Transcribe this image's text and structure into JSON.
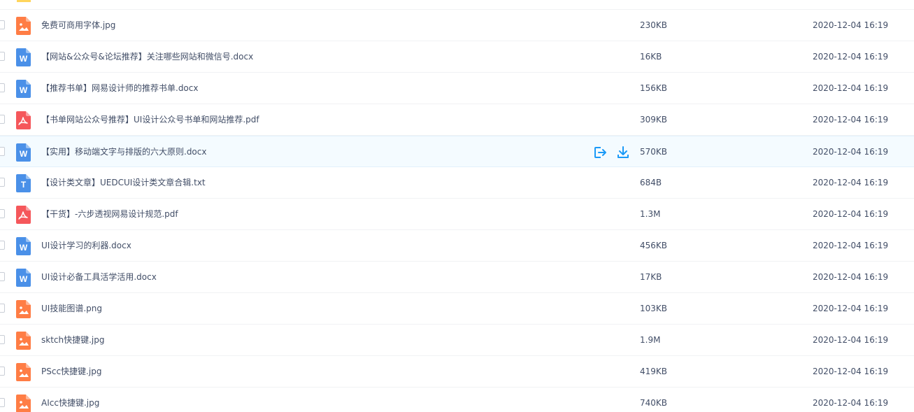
{
  "colors": {
    "word": "#4a90e8",
    "pdf": "#f5575b",
    "image": "#ff7d45",
    "txt": "#4a90e8",
    "folder": "#ffd55c",
    "action": "#1b9af7"
  },
  "files": [
    {
      "name": "免费可商用字体.jpg",
      "type": "image",
      "size": "230KB",
      "date": "2020-12-04 16:19"
    },
    {
      "name": "【网站&公众号&论坛推荐】关注哪些网站和微信号.docx",
      "type": "word",
      "size": "16KB",
      "date": "2020-12-04 16:19"
    },
    {
      "name": "【推荐书单】网易设计师的推荐书单.docx",
      "type": "word",
      "size": "156KB",
      "date": "2020-12-04 16:19"
    },
    {
      "name": "【书单网站公众号推荐】UI设计公众号书单和网站推荐.pdf",
      "type": "pdf",
      "size": "309KB",
      "date": "2020-12-04 16:19"
    },
    {
      "name": "【实用】移动端文字与排版的六大原则.docx",
      "type": "word",
      "size": "570KB",
      "date": "2020-12-04 16:19",
      "hover": true
    },
    {
      "name": "【设计类文章】UEDCUI设计类文章合辑.txt",
      "type": "txt",
      "size": "684B",
      "date": "2020-12-04 16:19"
    },
    {
      "name": "【干货】-六步透视网易设计规范.pdf",
      "type": "pdf",
      "size": "1.3M",
      "date": "2020-12-04 16:19"
    },
    {
      "name": "UI设计学习的利器.docx",
      "type": "word",
      "size": "456KB",
      "date": "2020-12-04 16:19"
    },
    {
      "name": "UI设计必备工具活学活用.docx",
      "type": "word",
      "size": "17KB",
      "date": "2020-12-04 16:19"
    },
    {
      "name": "UI技能图谱.png",
      "type": "image",
      "size": "103KB",
      "date": "2020-12-04 16:19"
    },
    {
      "name": "sktch快捷键.jpg",
      "type": "image",
      "size": "1.9M",
      "date": "2020-12-04 16:19"
    },
    {
      "name": "PScc快捷键.jpg",
      "type": "image",
      "size": "419KB",
      "date": "2020-12-04 16:19"
    },
    {
      "name": "AIcc快捷键.jpg",
      "type": "image",
      "size": "740KB",
      "date": "2020-12-04 16:19"
    }
  ]
}
